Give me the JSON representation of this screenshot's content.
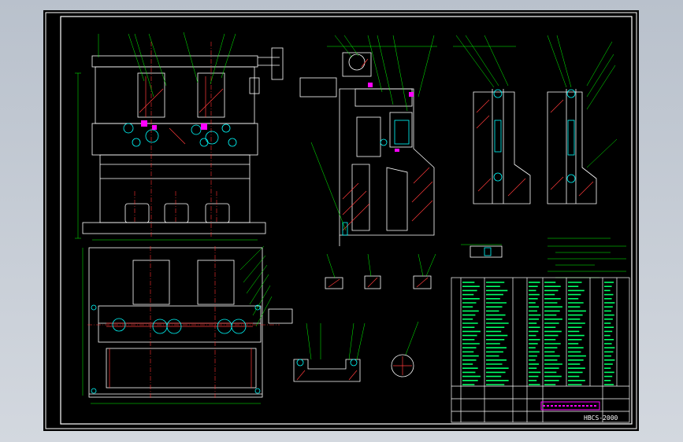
{
  "colors": {
    "background": "#000000",
    "viewport": "#c6cdd6",
    "geometry": "#ffffff",
    "dimension": "#00ff00",
    "hatch": "#ff3b3b",
    "center_line": "#ff3030",
    "parts": "#00ffff",
    "accent": "#ff00ff",
    "table": "#00ff66"
  },
  "title_block": {
    "drawing_number": "HBCS-2000"
  }
}
